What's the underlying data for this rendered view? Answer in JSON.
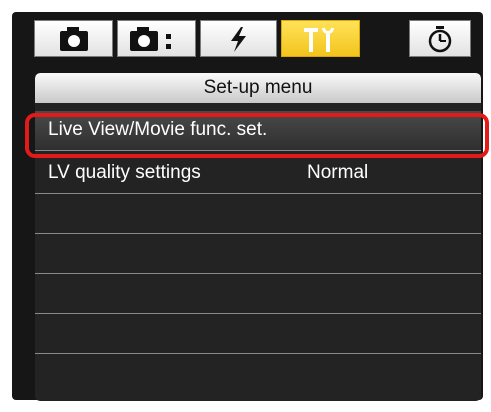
{
  "tabs": [
    {
      "icon": "camera-icon",
      "active": false
    },
    {
      "icon": "camera-settings-icon",
      "active": false
    },
    {
      "icon": "flash-icon",
      "active": false
    },
    {
      "icon": "wrench-icon",
      "active": true
    },
    {
      "icon": "timer-icon",
      "active": false
    }
  ],
  "menu": {
    "title": "Set-up menu",
    "items": [
      {
        "label": "Live View/Movie func. set.",
        "value": "",
        "selected": true
      },
      {
        "label": "LV quality settings",
        "value": "Normal",
        "selected": false
      },
      {
        "label": "",
        "value": "",
        "selected": false
      },
      {
        "label": "",
        "value": "",
        "selected": false
      },
      {
        "label": "",
        "value": "",
        "selected": false
      },
      {
        "label": "",
        "value": "",
        "selected": false
      }
    ]
  },
  "colors": {
    "active_tab": "#f3c41c",
    "highlight": "#e21a1a",
    "menu_bg": "#232323"
  }
}
